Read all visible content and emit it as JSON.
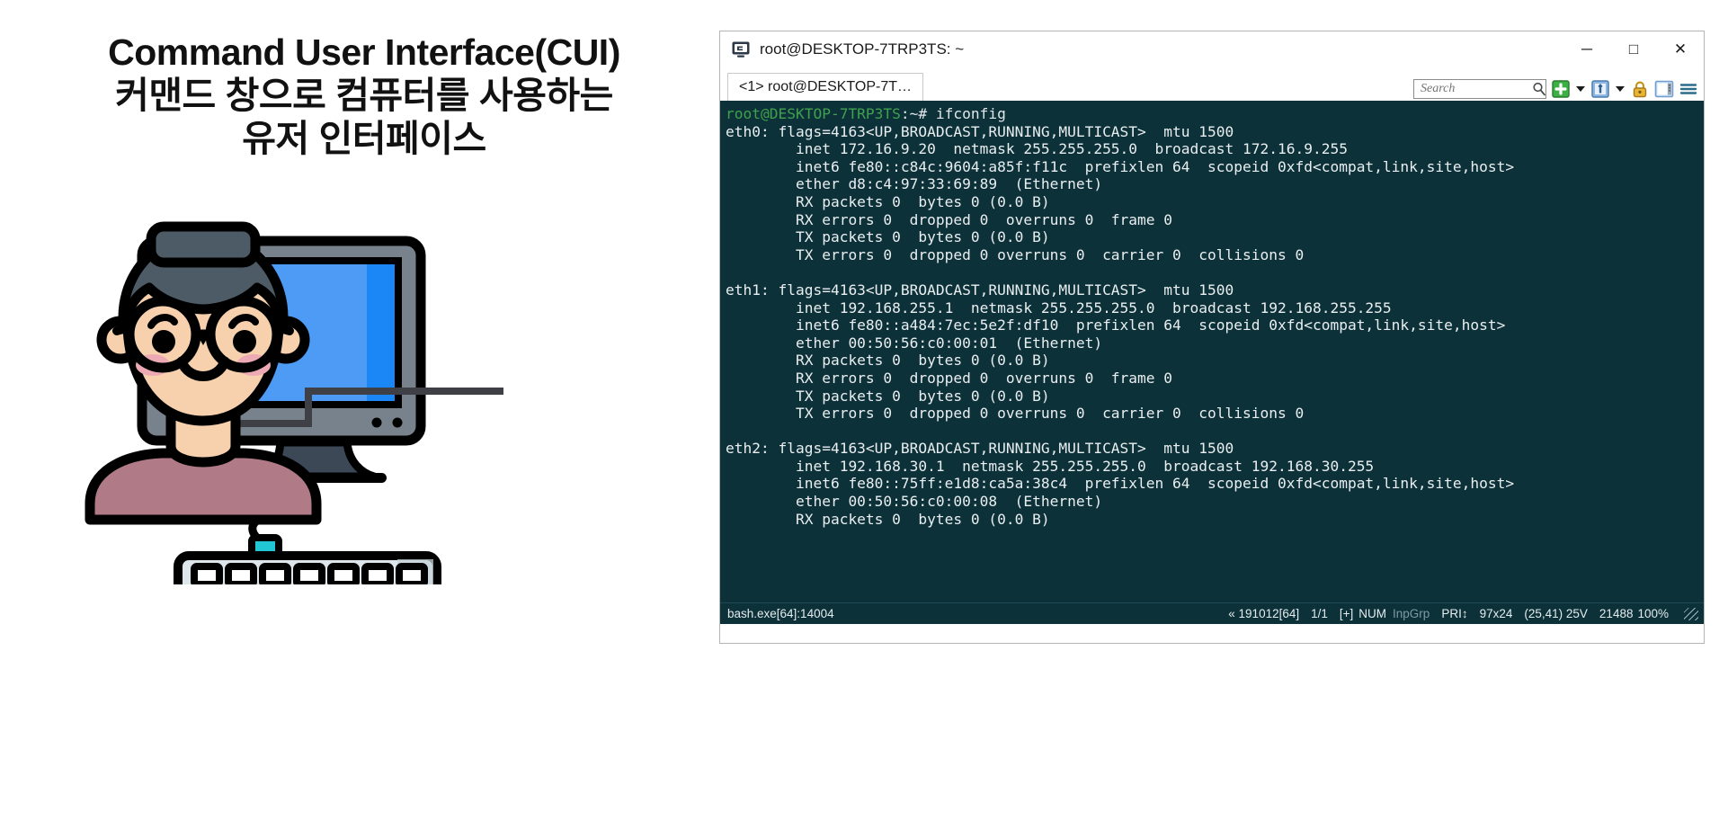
{
  "heading": {
    "line1": "Command User Interface(CUI)",
    "line2": "커맨드 창으로 컴퓨터를 사용하는",
    "line3": "유저 인터페이스"
  },
  "illustration": {
    "person_label": "person-with-glasses",
    "monitor_label": "desktop-monitor",
    "keyboard_label": "keyboard",
    "colors": {
      "skin": "#f7d0ae",
      "hair": "#4d5b66",
      "shirt": "#b07a87",
      "cheek": "#eeaab4",
      "screen": "#4d9bf5",
      "screen_edge": "#1b87f7",
      "bezel": "#78828d",
      "stand": "#3c4856",
      "keyboard": "#dde6ea",
      "connector": "#22c7d6",
      "outline": "#000000",
      "pointer_line": "#3e4046"
    }
  },
  "window": {
    "title": "root@DESKTOP-7TRP3TS: ~",
    "app_icon": "console-icon",
    "controls": {
      "minimize": "─",
      "maximize": "□",
      "close": "✕"
    },
    "tabs": [
      {
        "label": "<1> root@DESKTOP-7T…",
        "active": true
      }
    ],
    "toolbar": {
      "search_placeholder": "Search",
      "search_value": "",
      "icons": [
        "search-icon",
        "new-tab-plus-icon",
        "new-tab-dropdown-caret",
        "window-split-icon",
        "window-split-dropdown-caret",
        "lock-icon",
        "panel-toggle-icon",
        "hamburger-menu-icon"
      ],
      "accent_green": "#3cb043",
      "accent_blue": "#5691d0",
      "accent_gold": "#d9a21b"
    },
    "console": {
      "background": "#0d3139",
      "foreground": "#e9eef0",
      "prompt_color": "#3fa14e",
      "prompt_user": "root@DESKTOP-7TRP3TS",
      "prompt_tail": ":~# ",
      "command": "ifconfig",
      "lines": [
        "eth0: flags=4163<UP,BROADCAST,RUNNING,MULTICAST>  mtu 1500",
        "        inet 172.16.9.20  netmask 255.255.255.0  broadcast 172.16.9.255",
        "        inet6 fe80::c84c:9604:a85f:f11c  prefixlen 64  scopeid 0xfd<compat,link,site,host>",
        "        ether d8:c4:97:33:69:89  (Ethernet)",
        "        RX packets 0  bytes 0 (0.0 B)",
        "        RX errors 0  dropped 0  overruns 0  frame 0",
        "        TX packets 0  bytes 0 (0.0 B)",
        "        TX errors 0  dropped 0 overruns 0  carrier 0  collisions 0",
        "",
        "eth1: flags=4163<UP,BROADCAST,RUNNING,MULTICAST>  mtu 1500",
        "        inet 192.168.255.1  netmask 255.255.255.0  broadcast 192.168.255.255",
        "        inet6 fe80::a484:7ec:5e2f:df10  prefixlen 64  scopeid 0xfd<compat,link,site,host>",
        "        ether 00:50:56:c0:00:01  (Ethernet)",
        "        RX packets 0  bytes 0 (0.0 B)",
        "        RX errors 0  dropped 0  overruns 0  frame 0",
        "        TX packets 0  bytes 0 (0.0 B)",
        "        TX errors 0  dropped 0 overruns 0  carrier 0  collisions 0",
        "",
        "eth2: flags=4163<UP,BROADCAST,RUNNING,MULTICAST>  mtu 1500",
        "        inet 192.168.30.1  netmask 255.255.255.0  broadcast 192.168.30.255",
        "        inet6 fe80::75ff:e1d8:ca5a:38c4  prefixlen 64  scopeid 0xfd<compat,link,site,host>",
        "        ether 00:50:56:c0:00:08  (Ethernet)",
        "        RX packets 0  bytes 0 (0.0 B)"
      ]
    },
    "statusbar": {
      "process": "bash.exe[64]:14004",
      "build": "« 191012[64]",
      "pages": "1/1",
      "plus": "[+]",
      "num": "NUM",
      "inpgrp": "InpGrp",
      "pri": "PRI↕",
      "size": "97x24",
      "cursor": "(25,41) 25V",
      "memory": "21488",
      "zoom": "100%"
    }
  }
}
